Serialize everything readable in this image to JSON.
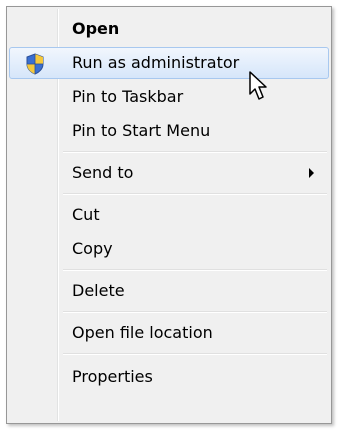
{
  "context_menu": {
    "items": [
      {
        "label": "Open",
        "bold": true
      },
      {
        "label": "Run as administrator",
        "icon": "uac-shield-icon",
        "highlighted": true
      },
      {
        "label": "Pin to Taskbar"
      },
      {
        "label": "Pin to Start Menu"
      },
      {
        "label": "Send to",
        "submenu": true
      },
      {
        "label": "Cut"
      },
      {
        "label": "Copy"
      },
      {
        "label": "Delete"
      },
      {
        "label": "Open file location"
      },
      {
        "label": "Properties"
      }
    ]
  },
  "colors": {
    "menu_background": "#f0f0f0",
    "highlight_top": "#f1f6fd",
    "highlight_bottom": "#d6e6fa",
    "highlight_border": "#a8c8ef"
  }
}
